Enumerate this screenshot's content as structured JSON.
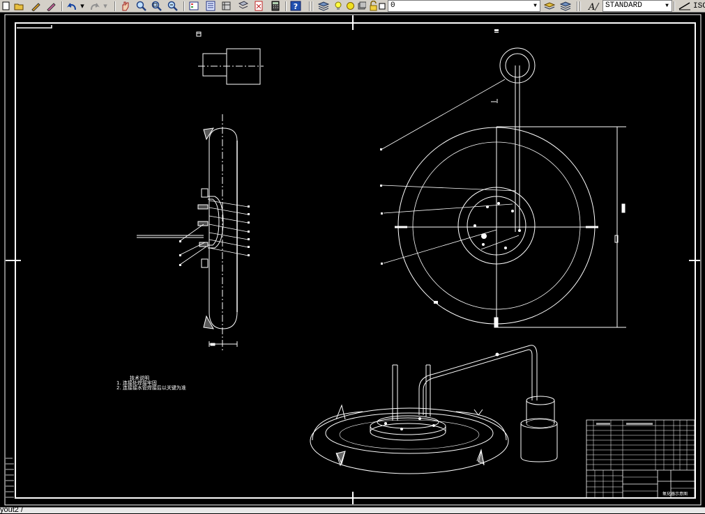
{
  "toolbar": {
    "layer_combo_value": "0",
    "textstyle_combo_value": "STANDARD",
    "right_clip_text": "ISC",
    "icons": [
      "new-icon",
      "open-icon",
      "pencil-icon",
      "eraser-icon",
      "undo-icon",
      "redo-icon",
      "pan-icon",
      "zoom-realtime-icon",
      "zoom-window-icon",
      "zoom-previous-icon",
      "properties-icon",
      "design-center-icon",
      "tool-palettes-icon",
      "sheet-set-icon",
      "markup-icon",
      "calculator-icon",
      "help-icon",
      "layer-manager-icon",
      "bulb-icon",
      "sun-icon",
      "freeze-icon",
      "lock-icon",
      "color-square-icon",
      "layer-previous-icon",
      "layer-state-icon",
      "text-style-icon",
      "dim-style-icon"
    ]
  },
  "drawing": {
    "notes_title": "技术说明",
    "notes_line1": "1. 连接处焊接牢固",
    "notes_line2": "2. 连接接水管焊接后以关键为准",
    "titleblock_name": "氧化器示意图",
    "colors": {
      "background": "#000000",
      "lines": "#ffffff"
    }
  },
  "status": {
    "layout_tab": "yout2 /"
  }
}
